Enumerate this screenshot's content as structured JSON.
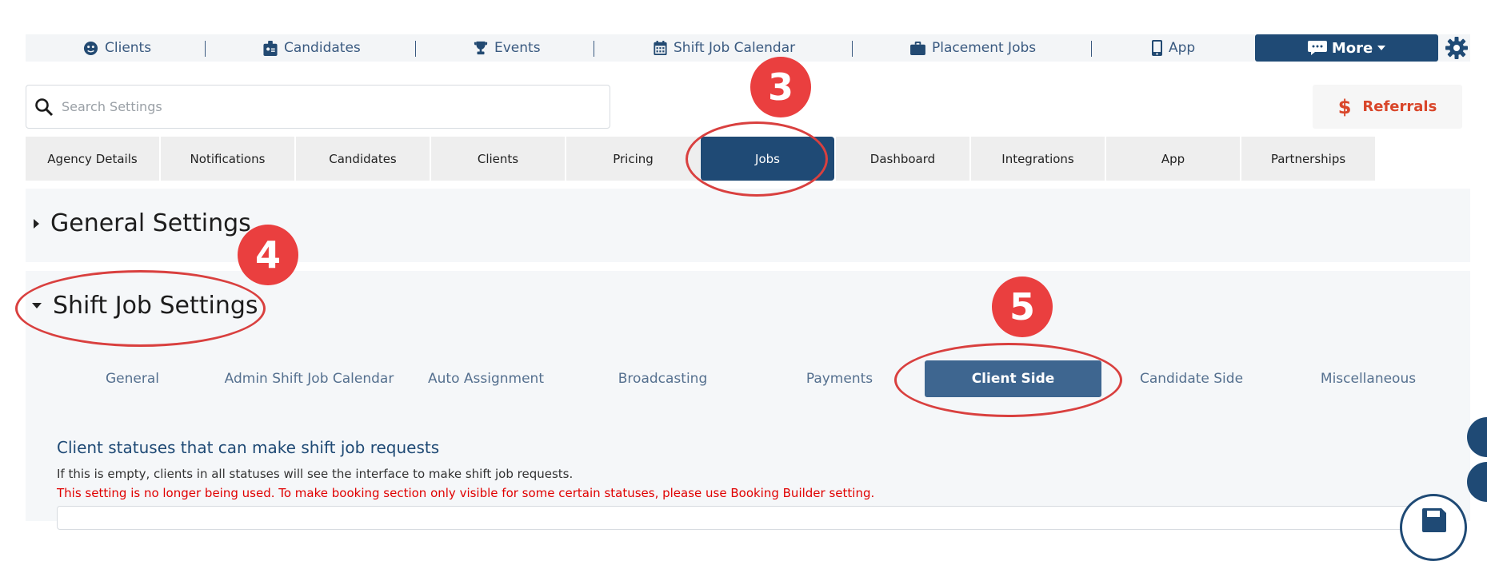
{
  "nav": {
    "items": [
      {
        "label": "Clients",
        "icon": "user-circle-icon"
      },
      {
        "label": "Candidates",
        "icon": "id-badge-icon"
      },
      {
        "label": "Events",
        "icon": "trophy-icon"
      },
      {
        "label": "Shift Job Calendar",
        "icon": "calendar-icon"
      },
      {
        "label": "Placement Jobs",
        "icon": "briefcase-icon"
      },
      {
        "label": "App",
        "icon": "mobile-icon"
      }
    ],
    "more_label": "More",
    "more_icon": "chat-bubble-icon",
    "settings_icon": "gear-icon"
  },
  "search": {
    "placeholder": "Search Settings",
    "icon": "search-icon"
  },
  "referrals": {
    "label": "Referrals",
    "icon": "dollar-icon"
  },
  "settings_tabs": [
    "Agency Details",
    "Notifications",
    "Candidates",
    "Clients",
    "Pricing",
    "Jobs",
    "Dashboard",
    "Integrations",
    "App",
    "Partnerships"
  ],
  "active_tab": "Jobs",
  "sections": {
    "general": "General Settings",
    "shift_job": "Shift Job Settings"
  },
  "subtabs": [
    "General",
    "Admin Shift Job Calendar",
    "Auto Assignment",
    "Broadcasting",
    "Payments",
    "Client Side",
    "Candidate Side",
    "Miscellaneous"
  ],
  "active_subtab": "Client Side",
  "content": {
    "heading": "Client statuses that can make shift job requests",
    "description": "If this is empty, clients in all statuses will see the interface to make shift job requests.",
    "warning": "This setting is no longer being used. To make booking section only visible for some certain statuses, please use Booking Builder setting."
  },
  "annotations": {
    "step3": "3",
    "step4": "4",
    "step5": "5"
  },
  "colors": {
    "primary": "#1f4a75",
    "accent_red": "#ea3f3f",
    "warning": "#e00000",
    "referral": "#d9462a"
  }
}
